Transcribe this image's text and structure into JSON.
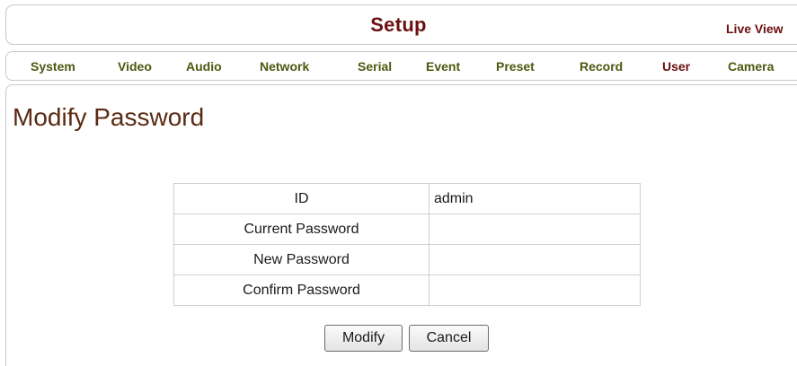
{
  "header": {
    "title": "Setup",
    "live_view_link": "Live View"
  },
  "nav": {
    "items": [
      {
        "label": "System",
        "active": false
      },
      {
        "label": "Video",
        "active": false
      },
      {
        "label": "Audio",
        "active": false
      },
      {
        "label": "Network",
        "active": false
      },
      {
        "label": "Serial",
        "active": false
      },
      {
        "label": "Event",
        "active": false
      },
      {
        "label": "Preset",
        "active": false
      },
      {
        "label": "Record",
        "active": false
      },
      {
        "label": "User",
        "active": true
      },
      {
        "label": "Camera",
        "active": false
      }
    ]
  },
  "main": {
    "heading": "Modify Password",
    "form": {
      "rows": [
        {
          "label": "ID",
          "value": "admin",
          "editable": false
        },
        {
          "label": "Current Password",
          "value": "",
          "editable": true
        },
        {
          "label": "New Password",
          "value": "",
          "editable": true
        },
        {
          "label": "Confirm Password",
          "value": "",
          "editable": true
        }
      ]
    },
    "buttons": {
      "modify_label": "Modify",
      "cancel_label": "Cancel"
    }
  },
  "colors": {
    "title": "#6b0f0f",
    "nav_text": "#4b5a10",
    "nav_active": "#6b0f0f",
    "heading": "#5a2a12",
    "border": "#c8c8c8"
  }
}
